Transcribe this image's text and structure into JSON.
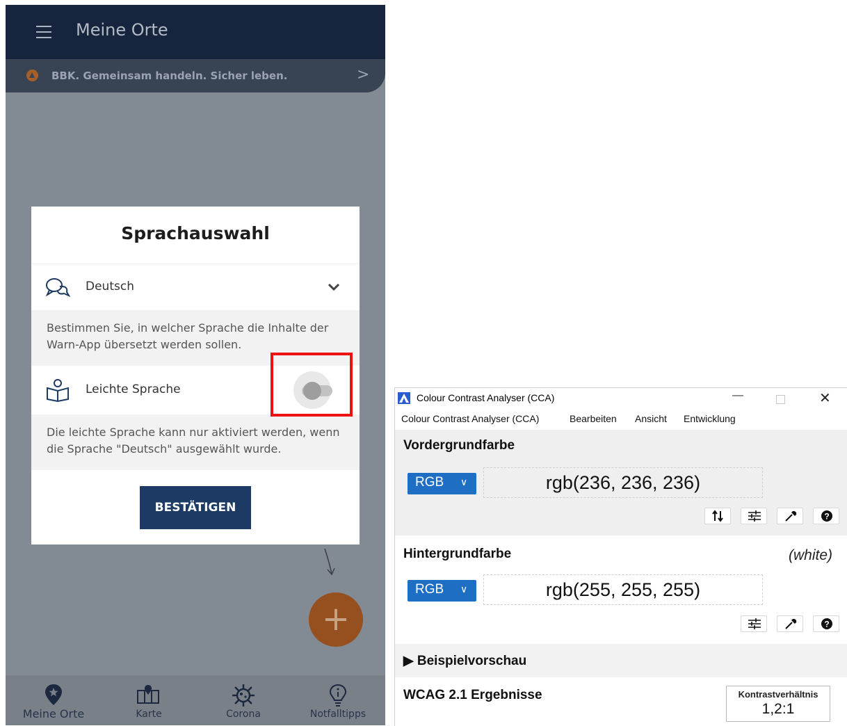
{
  "phone": {
    "app_bar": {
      "title": "Meine Orte"
    },
    "banner": {
      "text": "BBK. Gemeinsam handeln. Sicher leben.",
      "chevron": ">"
    },
    "dialog": {
      "title": "Sprachauswahl",
      "language": {
        "selected": "Deutsch"
      },
      "language_info": "Bestimmen Sie, in welcher Sprache die Inhalte der Warn-App übersetzt werden sollen.",
      "easy_language": {
        "label": "Leichte Sprache",
        "enabled": false
      },
      "easy_language_info": "Die leichte Sprache kann nur aktiviert werden, wenn die Sprache \"Deutsch\" ausgewählt wurde.",
      "confirm_label": "BESTÄTIGEN"
    },
    "fab": {
      "label": "+"
    },
    "bottom_nav": {
      "items": [
        {
          "label": "Meine Orte",
          "icon": "pin-star-icon"
        },
        {
          "label": "Karte",
          "icon": "map-icon"
        },
        {
          "label": "Corona",
          "icon": "virus-icon"
        },
        {
          "label": "Notfalltipps",
          "icon": "lightbulb-icon"
        }
      ]
    },
    "colors": {
      "app_bar": "#16253d",
      "overlay": "#828a94",
      "confirm_button": "#1c3a63",
      "fab": "#96501f",
      "highlight": "#ee1111"
    }
  },
  "cca": {
    "window_title": "Colour Contrast Analyser (CCA)",
    "window_controls": {
      "minimize": "—",
      "close": "✕"
    },
    "menu": [
      "Colour Contrast Analyser (CCA)",
      "Bearbeiten",
      "Ansicht",
      "Entwicklung"
    ],
    "foreground": {
      "title": "Vordergrundfarbe",
      "format": "RGB",
      "value": "rgb(236, 236, 236)",
      "tools": [
        "swap-icon",
        "sliders-icon",
        "eyedropper-icon",
        "help-icon"
      ]
    },
    "background": {
      "title": "Hintergrundfarbe",
      "name_tag": "(white)",
      "format": "RGB",
      "value": "rgb(255, 255, 255)",
      "tools": [
        "sliders-icon",
        "eyedropper-icon",
        "help-icon"
      ]
    },
    "preview": {
      "label": "Beispielvorschau"
    },
    "results": {
      "title": "WCAG 2.1 Ergebnisse",
      "ratio_label": "Kontrastverhältnis",
      "ratio_value": "1,2:1"
    },
    "colors": {
      "format_button": "#1e6ec4",
      "section_bg": "#efefef"
    }
  }
}
